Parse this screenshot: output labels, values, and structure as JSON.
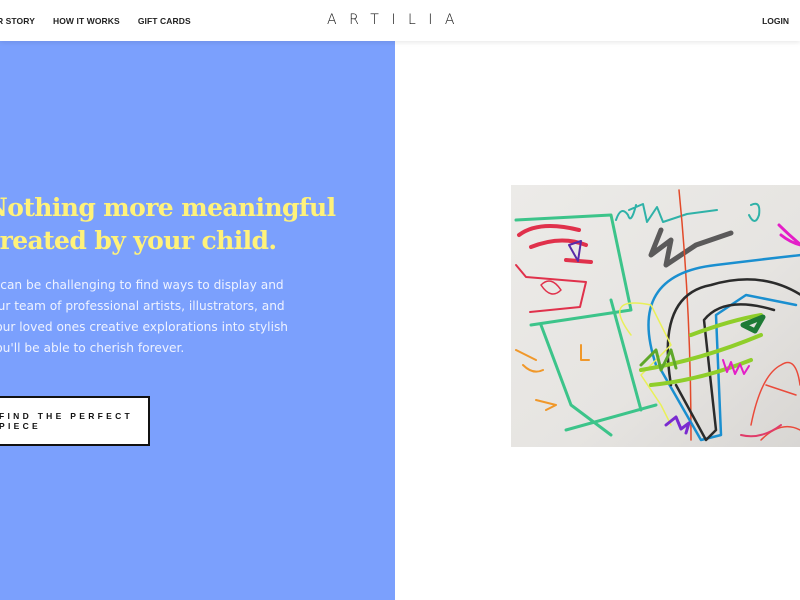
{
  "header": {
    "nav": [
      {
        "label": "OUR STORY"
      },
      {
        "label": "HOW IT WORKS"
      },
      {
        "label": "GIFT CARDS"
      }
    ],
    "logo": "ARTILIA",
    "login_label": "LOGIN"
  },
  "hero": {
    "headline_line1": "Nothing more meaningful",
    "headline_line2": "created by your child.",
    "body_lines": [
      "It can be challenging to find ways to display and",
      "Our team of professional artists, illustrators, and",
      "your loved ones creative explorations into stylish",
      "you'll be able to cherish forever."
    ],
    "cta_label": "FIND THE PERFECT PIECE",
    "image_alt": "child's colorful marker drawing"
  },
  "colors": {
    "hero_background": "#7ba0fd",
    "headline": "#fff27a",
    "body_text": "#eef2ff",
    "header_background": "#ffffff"
  }
}
